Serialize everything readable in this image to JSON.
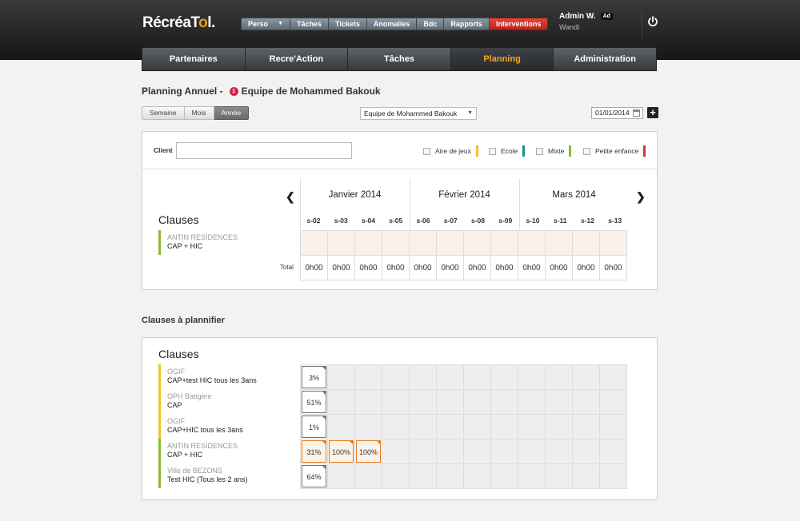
{
  "app": {
    "logo_main": "RécréaT",
    "logo_accent": "o",
    "logo_tail": "l.",
    "logo_mark": "o"
  },
  "topnav": [
    {
      "label": "Perso",
      "dropdown": "▼"
    },
    {
      "label": "Tâches"
    },
    {
      "label": "Tickets"
    },
    {
      "label": "Anomalies"
    },
    {
      "label": "Bdc"
    },
    {
      "label": "Rapports"
    },
    {
      "label": "Interventions",
      "highlight": "#cc2c22"
    }
  ],
  "user": {
    "name": "Admin W.",
    "badge": "Ad",
    "subtitle": "Wandi"
  },
  "mainnav": [
    {
      "label": "Partenaires"
    },
    {
      "label": "Recre'Action"
    },
    {
      "label": "Tâches"
    },
    {
      "label": "Planning",
      "active": true
    },
    {
      "label": "Administration"
    }
  ],
  "page": {
    "title": "Planning Annuel -",
    "team_count": "1",
    "team_name": "Equipe de Mohammed Bakouk"
  },
  "view": {
    "options": [
      "Semaine",
      "Mois",
      "Année"
    ],
    "selected": "Année"
  },
  "team_select": {
    "value": "Equipe de Mohammed Bakouk",
    "arrow": "▼"
  },
  "date": {
    "value": "01/01/2014"
  },
  "add_label": "+",
  "filter": {
    "client_label": "Client",
    "client_value": ""
  },
  "legend": [
    {
      "label": "Aire de jeux",
      "color": "#f2c32a"
    },
    {
      "label": "Ecole",
      "color": "#1b8a9a"
    },
    {
      "label": "Mixte",
      "color": "#8ab932"
    },
    {
      "label": "Petite enfance",
      "color": "#d8332f"
    }
  ],
  "calendar": {
    "prev": "❮",
    "next": "❯",
    "months": [
      "Janvier 2014",
      "Février 2014",
      "Mars 2014"
    ],
    "weeks": [
      "s-02",
      "s-03",
      "s-04",
      "s-05",
      "s-06",
      "s-07",
      "s-08",
      "s-09",
      "s-10",
      "s-11",
      "s-12",
      "s-13"
    ]
  },
  "clauses_title": "Clauses",
  "planned": {
    "rows": [
      {
        "client": "ANTIN RESIDENCES",
        "clause": "CAP + HIC",
        "color": "#8ab932"
      }
    ],
    "total_label": "Total",
    "totals": [
      "0h00",
      "0h00",
      "0h00",
      "0h00",
      "0h00",
      "0h00",
      "0h00",
      "0h00",
      "0h00",
      "0h00",
      "0h00",
      "0h00"
    ]
  },
  "to_plan_title": "Clauses à plannifier",
  "to_plan": {
    "title": "Clauses",
    "rows": [
      {
        "client": "OGIF",
        "clause": "CAP+test HIC tous les 3ans",
        "color": "#f2c32a",
        "cells": [
          "3%"
        ],
        "style": "g"
      },
      {
        "client": "OPH Batigère",
        "clause": "CAP",
        "color": "#f2c32a",
        "cells": [
          "51%"
        ],
        "style": "g"
      },
      {
        "client": "OGIF",
        "clause": "CAP+HIC tous les 3ans",
        "color": "#f2c32a",
        "cells": [
          "1%"
        ],
        "style": "g"
      },
      {
        "client": "ANTIN RESIDENCES",
        "clause": "CAP + HIC",
        "color": "#8ab932",
        "cells": [
          "31%",
          "100%",
          "100%"
        ],
        "style": "o"
      },
      {
        "client": "Ville de BEZONS",
        "clause": "Test HIC (Tous les 2 ans)",
        "color": "#8ab932",
        "cells": [
          "64%"
        ],
        "style": "g"
      }
    ]
  }
}
